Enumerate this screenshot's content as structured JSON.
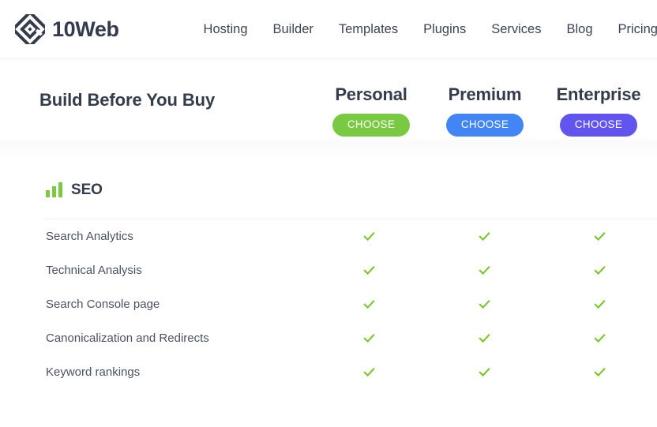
{
  "header": {
    "brand": {
      "logo_icon": "tenweb-diamond-logo-icon",
      "name": "10Web"
    },
    "nav": [
      {
        "label": "Hosting"
      },
      {
        "label": "Builder"
      },
      {
        "label": "Templates"
      },
      {
        "label": "Plugins"
      },
      {
        "label": "Services"
      },
      {
        "label": "Blog"
      },
      {
        "label": "Pricing"
      }
    ]
  },
  "pricing_bar": {
    "title": "Build Before You Buy",
    "plans": [
      {
        "name": "Personal",
        "cta": "CHOOSE",
        "color": "#7ac943"
      },
      {
        "name": "Premium",
        "cta": "CHOOSE",
        "color": "#4285f4"
      },
      {
        "name": "Enterprise",
        "cta": "CHOOSE",
        "color": "#6255ef"
      }
    ]
  },
  "feature_section": {
    "icon": "bar-chart-icon",
    "title": "SEO",
    "check_color": "#7cc62c",
    "rows": [
      {
        "label": "Search Analytics",
        "personal": "check",
        "premium": "check",
        "enterprise": "check"
      },
      {
        "label": "Technical Analysis",
        "personal": "check",
        "premium": "check",
        "enterprise": "check"
      },
      {
        "label": "Search Console page",
        "personal": "check",
        "premium": "check",
        "enterprise": "check"
      },
      {
        "label": "Canonicalization and Redirects",
        "personal": "check",
        "premium": "check",
        "enterprise": "check"
      },
      {
        "label": "Keyword rankings",
        "personal": "check",
        "premium": "check",
        "enterprise": "check"
      }
    ]
  }
}
